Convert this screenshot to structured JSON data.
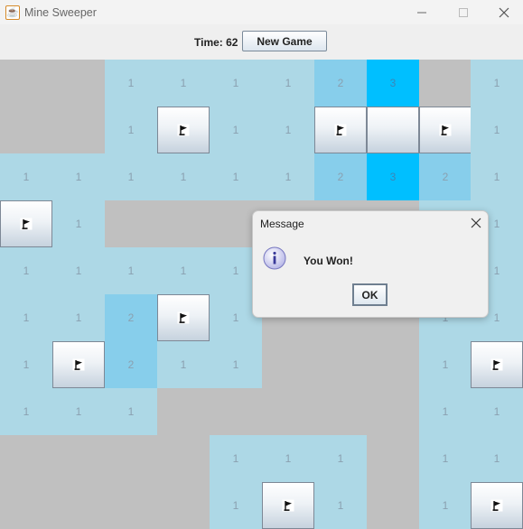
{
  "window": {
    "title": "Mine Sweeper",
    "app_icon": "java-icon",
    "controls": [
      "minimize-icon",
      "maximize-icon",
      "close-icon"
    ]
  },
  "toolbar": {
    "time_label": "Time: 62",
    "new_game_label": "New Game"
  },
  "board": {
    "rows": 10,
    "cols": 10,
    "legend": {
      "1": "revealed number 1",
      "2": "revealed number 2",
      "3": "revealed number 3",
      "F": "flagged cell",
      "B": "unrevealed button",
      ".": "revealed empty"
    },
    "colors": {
      "n1": "#add8e6",
      "n2": "#87ceeb",
      "n3": "#00bfff",
      "blank": "#c0c0c0"
    },
    "grid": [
      [
        ".",
        ".",
        "1",
        "1",
        "1",
        "1",
        "2",
        "3",
        ".",
        "1"
      ],
      [
        ".",
        ".",
        "1",
        "F",
        "1",
        "1",
        "F",
        "B",
        "F",
        "1"
      ],
      [
        "1",
        "1",
        "1",
        "1",
        "1",
        "1",
        "2",
        "3",
        "2",
        "1"
      ],
      [
        "F",
        "1",
        ".",
        ".",
        ".",
        ".",
        ".",
        ".",
        "1",
        "1"
      ],
      [
        "1",
        "1",
        "1",
        "1",
        "1",
        ".",
        ".",
        ".",
        "1",
        "1"
      ],
      [
        "1",
        "1",
        "2",
        "F",
        "1",
        ".",
        ".",
        ".",
        "1",
        "1"
      ],
      [
        "1",
        "F",
        "2",
        "1",
        "1",
        ".",
        ".",
        ".",
        "1",
        "F"
      ],
      [
        "1",
        "1",
        "1",
        ".",
        ".",
        ".",
        ".",
        ".",
        "1",
        "1"
      ],
      [
        ".",
        ".",
        ".",
        ".",
        "1",
        "1",
        "1",
        ".",
        "1",
        "1"
      ],
      [
        ".",
        ".",
        ".",
        ".",
        "1",
        "F",
        "1",
        ".",
        "1",
        "F"
      ]
    ]
  },
  "dialog": {
    "title": "Message",
    "message": "You Won!",
    "ok_label": "OK",
    "icon": "info-icon"
  }
}
